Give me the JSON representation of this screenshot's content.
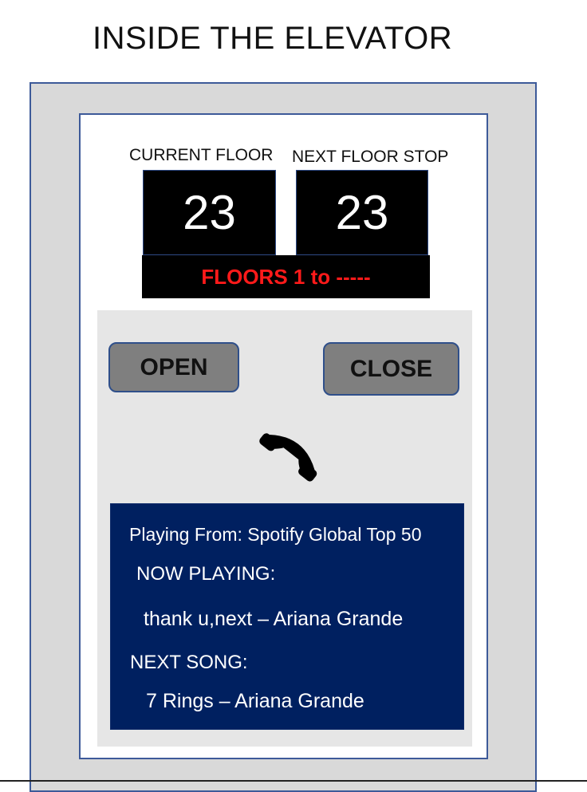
{
  "page": {
    "title": "INSIDE THE ELEVATOR"
  },
  "display": {
    "current_floor_label": "CURRENT FLOOR",
    "current_floor_value": "23",
    "next_stop_label": "NEXT FLOOR STOP",
    "next_stop_value": "23",
    "range_text": "FLOORS 1 to -----",
    "range_color": "#ff1a1a"
  },
  "controls": {
    "open_label": "OPEN",
    "close_label": "CLOSE",
    "phone_icon": "phone-icon"
  },
  "music": {
    "source": "Playing From: Spotify Global Top 50",
    "now_playing_label": "NOW PLAYING:",
    "now_playing": "thank u,next – Ariana Grande",
    "next_song_label": "NEXT SONG:",
    "next_song": "7 Rings – Ariana Grande",
    "background": "#002060"
  }
}
